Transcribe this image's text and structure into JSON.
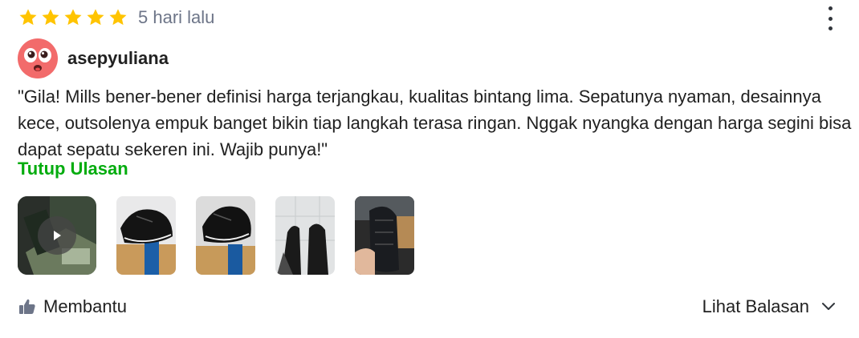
{
  "review": {
    "rating": 5,
    "rating_max": 5,
    "time": "5 hari lalu",
    "username": "asepyuliana",
    "text": "\"Gila! Mills bener-bener definisi harga terjangkau, kualitas bintang lima. Sepatunya nyaman, desainnya kece, outsolenya empuk banget bikin tiap langkah terasa ringan. Nggak nyangka dengan harga segini bisa dapat sepatu sekeren ini. Wajib punya!\"",
    "toggle_label": "Tutup Ulasan",
    "media": [
      {
        "type": "video",
        "icon": "play-icon"
      },
      {
        "type": "image"
      },
      {
        "type": "image"
      },
      {
        "type": "image"
      },
      {
        "type": "image"
      }
    ]
  },
  "actions": {
    "helpful_label": "Membantu",
    "replies_label": "Lihat Balasan"
  },
  "colors": {
    "star": "#ffc400",
    "accent_green": "#03ac0e",
    "muted_text": "#6d7588",
    "avatar": "#f26b6b"
  }
}
